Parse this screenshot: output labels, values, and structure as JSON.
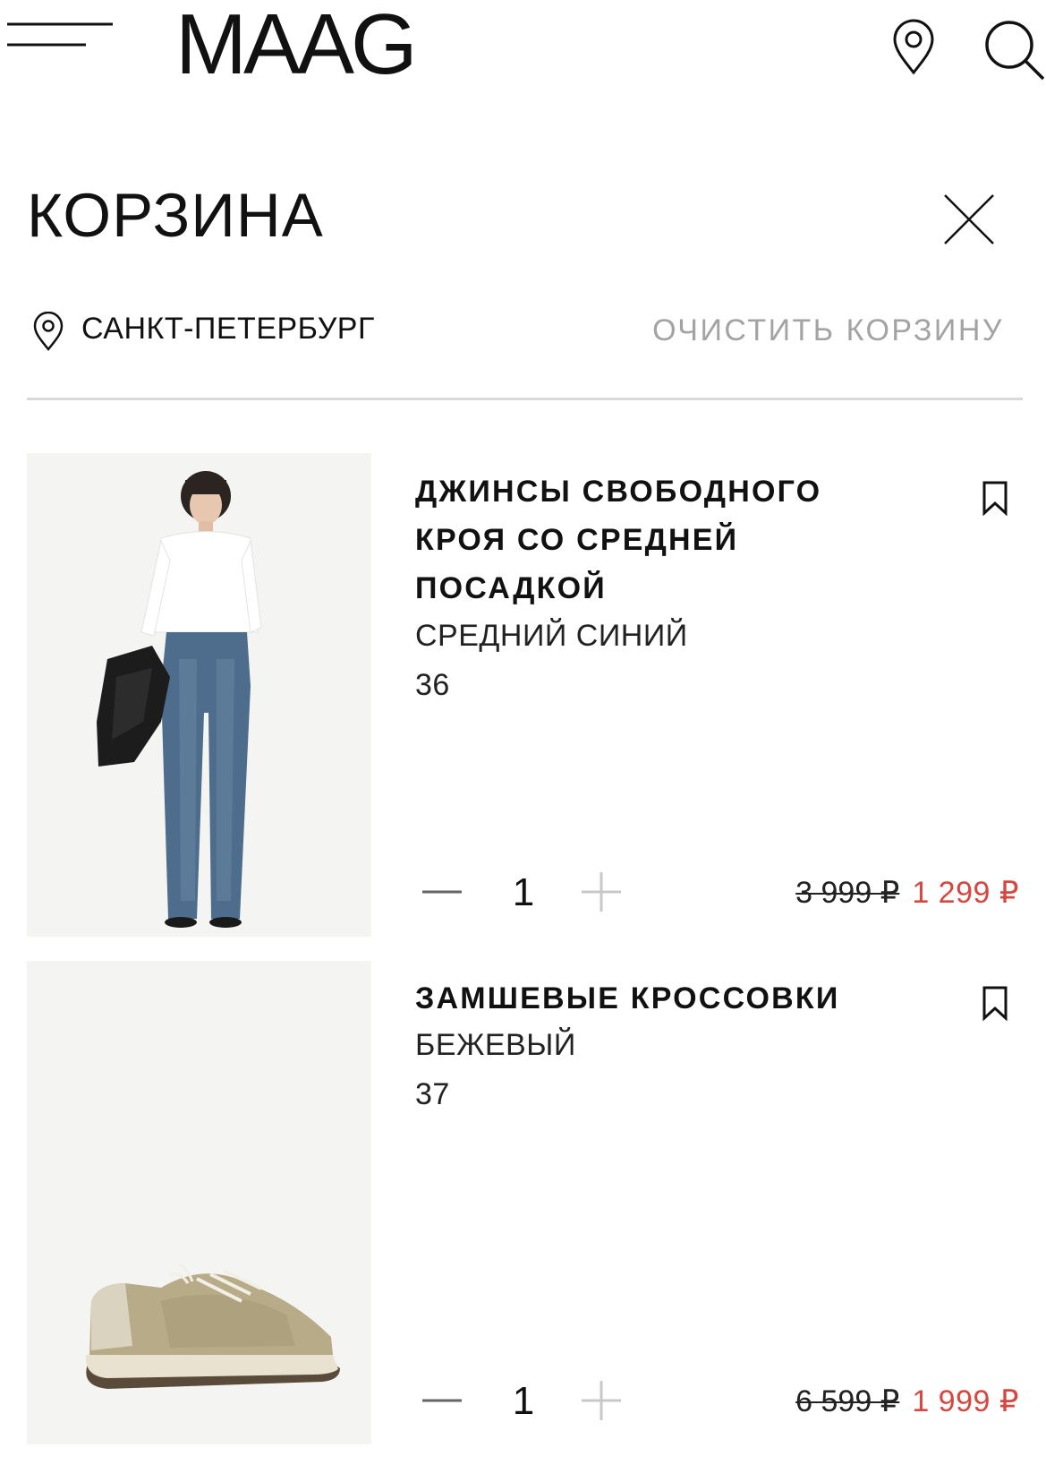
{
  "header": {
    "logo": "MAAG",
    "menu_icon": "hamburger-menu-icon",
    "location_icon": "map-pin-icon",
    "search_icon": "search-icon"
  },
  "cart": {
    "title": "КОРЗИНА",
    "close_icon": "close-icon",
    "city": "САНКТ-ПЕТЕРБУРГ",
    "clear_label": "ОЧИСТИТЬ КОРЗИНУ"
  },
  "items": [
    {
      "name_lines": [
        "ДЖИНСЫ СВОБОДНОГО",
        "КРОЯ СО СРЕДНЕЙ",
        "ПОСАДКОЙ"
      ],
      "color": "СРЕДНИЙ СИНИЙ",
      "size": "36",
      "quantity": "1",
      "old_price": "3 999 ₽",
      "new_price": "1 299 ₽"
    },
    {
      "name_lines": [
        "ЗАМШЕВЫЕ КРОССОВКИ"
      ],
      "color": "БЕЖЕВЫЙ",
      "size": "37",
      "quantity": "1",
      "old_price": "6 599 ₽",
      "new_price": "1 999 ₽"
    }
  ],
  "colors": {
    "sale_price": "#d6483f",
    "muted_text": "#a3a3a3",
    "divider": "#d9d9d9"
  }
}
